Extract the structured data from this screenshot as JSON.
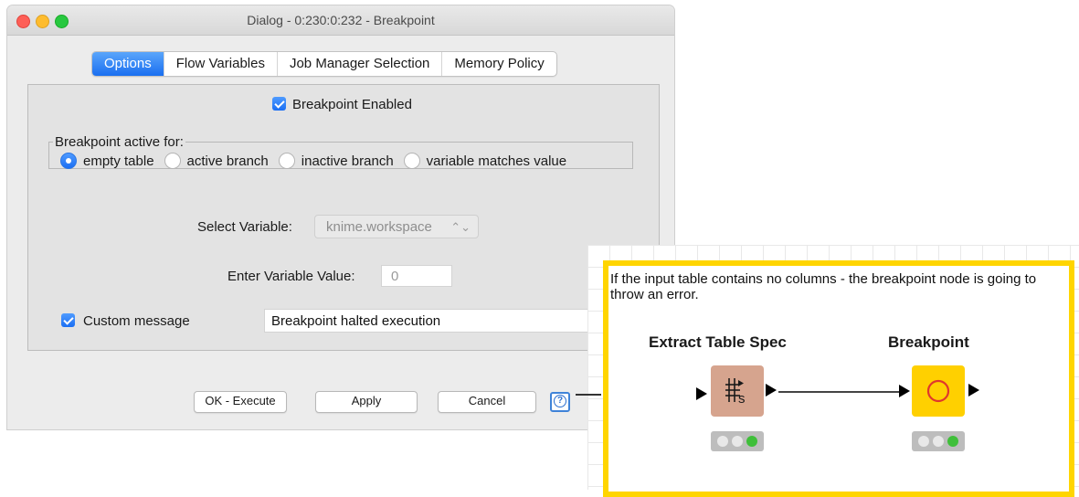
{
  "window": {
    "title": "Dialog - 0:230:0:232 - Breakpoint"
  },
  "tabs": [
    {
      "label": "Options",
      "active": true
    },
    {
      "label": "Flow Variables",
      "active": false
    },
    {
      "label": "Job Manager Selection",
      "active": false
    },
    {
      "label": "Memory Policy",
      "active": false
    }
  ],
  "options": {
    "breakpoint_enabled_label": "Breakpoint Enabled",
    "breakpoint_enabled_checked": true,
    "active_for_legend": "Breakpoint active for:",
    "active_for_options": [
      {
        "label": "empty table",
        "selected": true
      },
      {
        "label": "active branch",
        "selected": false
      },
      {
        "label": "inactive branch",
        "selected": false
      },
      {
        "label": "variable matches value",
        "selected": false
      }
    ],
    "select_variable_label": "Select Variable:",
    "select_variable_value": "knime.workspace",
    "enter_value_label": "Enter Variable Value:",
    "enter_value_value": "0",
    "custom_message_label": "Custom message",
    "custom_message_checked": true,
    "custom_message_value": "Breakpoint halted execution"
  },
  "buttons": {
    "ok_execute": "OK - Execute",
    "apply": "Apply",
    "cancel": "Cancel",
    "help_icon": "help-icon"
  },
  "workflow": {
    "annotation_text": "If the input table contains no columns - the breakpoint node is going to throw an error.",
    "annotation_border_color": "#ffd500",
    "nodes": [
      {
        "title": "Extract Table Spec",
        "color": "#d6a48e",
        "icon": "table-spec-icon"
      },
      {
        "title": "Breakpoint",
        "color": "#ffd000",
        "icon": "breakpoint-circle-icon"
      }
    ]
  },
  "colors": {
    "accent": "#1b6ef3",
    "status_green": "#3fbf3a"
  }
}
